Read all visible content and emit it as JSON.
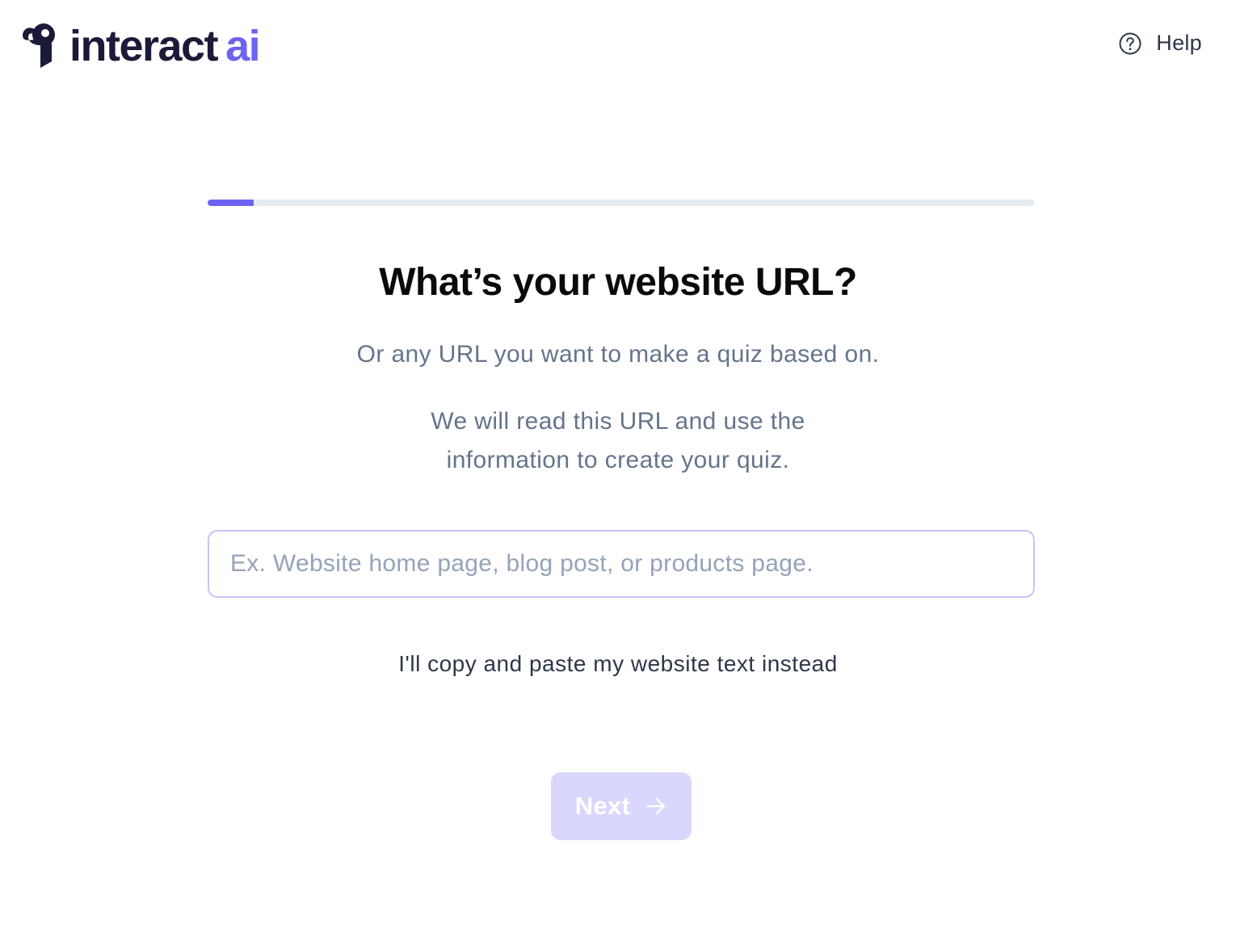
{
  "brand": {
    "name": "interact",
    "suffix": "ai",
    "logo_icon": "interact-logo-icon",
    "colors": {
      "dark": "#1b1a38",
      "accent": "#6d63f0"
    }
  },
  "header": {
    "help_label": "Help",
    "help_icon": "question-circle-icon"
  },
  "progress": {
    "fraction": 0.056
  },
  "step": {
    "title": "What’s your website URL?",
    "subtitle": "Or any URL you want to make a quiz based on.",
    "description": "We will read this URL and use the information to create your quiz."
  },
  "url_input": {
    "value": "",
    "placeholder": "Ex. Website home page, blog post, or products page."
  },
  "alt_option": {
    "label": "I'll copy and paste my website text instead"
  },
  "next_button": {
    "label": "Next",
    "icon": "arrow-right-icon",
    "state": "disabled"
  }
}
